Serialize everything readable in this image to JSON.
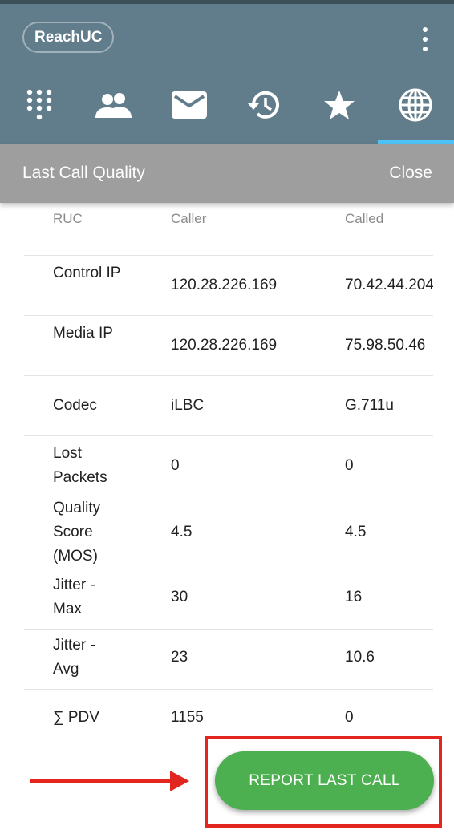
{
  "app": {
    "brand": "ReachUC"
  },
  "tabs": [
    {
      "icon": "dialpad-icon"
    },
    {
      "icon": "contacts-icon"
    },
    {
      "icon": "messages-icon"
    },
    {
      "icon": "history-icon"
    },
    {
      "icon": "favorites-icon"
    },
    {
      "icon": "globe-icon",
      "active": true
    }
  ],
  "subheader": {
    "title": "Last Call Quality",
    "close_label": "Close"
  },
  "table": {
    "headers": [
      "RUC",
      "Caller",
      "Called"
    ],
    "rows": [
      {
        "label": "Control IP",
        "caller": "120.28.226.169",
        "called": "70.42.44.204"
      },
      {
        "label": "Media IP",
        "caller": "120.28.226.169",
        "called": "75.98.50.46"
      },
      {
        "label": "Codec",
        "caller": "iLBC",
        "called": "G.711u"
      },
      {
        "label": "Lost Packets",
        "caller": "0",
        "called": "0"
      },
      {
        "label": "Quality Score (MOS)",
        "caller": "4.5",
        "called": "4.5"
      },
      {
        "label": "Jitter - Max",
        "caller": "30",
        "called": "16"
      },
      {
        "label": "Jitter - Avg",
        "caller": "23",
        "called": "10.6"
      },
      {
        "label": "∑ PDV",
        "caller": "1155",
        "called": "0"
      }
    ]
  },
  "actions": {
    "report_label": "REPORT LAST CALL"
  },
  "colors": {
    "header": "#617c8a",
    "subheader": "#9e9e9e",
    "accent": "#4fc3f7",
    "button": "#4caf50",
    "annotation": "#e3251f"
  }
}
